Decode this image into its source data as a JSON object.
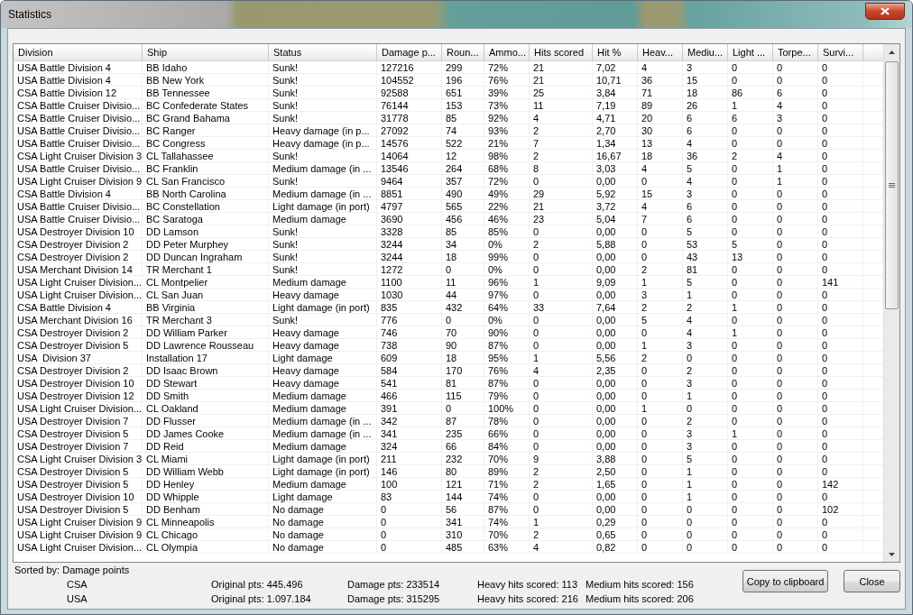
{
  "window": {
    "title": "Statistics"
  },
  "table": {
    "columns": [
      "Division",
      "Ship",
      "Status",
      "Damage p...",
      "Roun...",
      "Ammo...",
      "Hits scored",
      "Hit %",
      "Heav...",
      "Mediu...",
      "Light ...",
      "Torpe...",
      "Survi..."
    ],
    "rows": [
      [
        "USA Battle Division 4",
        "BB Idaho",
        "Sunk!",
        "127216",
        "299",
        "72%",
        "21",
        "7,02",
        "4",
        "3",
        "0",
        "0",
        "0"
      ],
      [
        "USA Battle Division 4",
        "BB New York",
        "Sunk!",
        "104552",
        "196",
        "76%",
        "21",
        "10,71",
        "36",
        "15",
        "0",
        "0",
        "0"
      ],
      [
        "CSA Battle Division 12",
        "BB Tennessee",
        "Sunk!",
        "92588",
        "651",
        "39%",
        "25",
        "3,84",
        "71",
        "18",
        "86",
        "6",
        "0"
      ],
      [
        "CSA Battle Cruiser Divisio...",
        "BC Confederate States",
        "Sunk!",
        "76144",
        "153",
        "73%",
        "11",
        "7,19",
        "89",
        "26",
        "1",
        "4",
        "0"
      ],
      [
        "CSA Battle Cruiser Divisio...",
        "BC Grand Bahama",
        "Sunk!",
        "31778",
        "85",
        "92%",
        "4",
        "4,71",
        "20",
        "6",
        "6",
        "3",
        "0"
      ],
      [
        "USA Battle Cruiser Divisio...",
        "BC Ranger",
        "Heavy damage (in p...",
        "27092",
        "74",
        "93%",
        "2",
        "2,70",
        "30",
        "6",
        "0",
        "0",
        "0"
      ],
      [
        "USA Battle Cruiser Divisio...",
        "BC Congress",
        "Heavy damage (in p...",
        "14576",
        "522",
        "21%",
        "7",
        "1,34",
        "13",
        "4",
        "0",
        "0",
        "0"
      ],
      [
        "CSA Light Cruiser Division 3",
        "CL Tallahassee",
        "Sunk!",
        "14064",
        "12",
        "98%",
        "2",
        "16,67",
        "18",
        "36",
        "2",
        "4",
        "0"
      ],
      [
        "USA Battle Cruiser Divisio...",
        "BC Franklin",
        "Medium damage (in ...",
        "13546",
        "264",
        "68%",
        "8",
        "3,03",
        "4",
        "5",
        "0",
        "1",
        "0"
      ],
      [
        "USA Light Cruiser Division 9",
        "CL San Francisco",
        "Sunk!",
        "9464",
        "357",
        "72%",
        "0",
        "0,00",
        "0",
        "4",
        "0",
        "1",
        "0"
      ],
      [
        "CSA Battle Division 4",
        "BB North Carolina",
        "Medium damage (in ...",
        "8851",
        "490",
        "49%",
        "29",
        "5,92",
        "15",
        "3",
        "0",
        "0",
        "0"
      ],
      [
        "USA Battle Cruiser Divisio...",
        "BC Constellation",
        "Light damage (in port)",
        "4797",
        "565",
        "22%",
        "21",
        "3,72",
        "4",
        "6",
        "0",
        "0",
        "0"
      ],
      [
        "USA Battle Cruiser Divisio...",
        "BC Saratoga",
        "Medium damage",
        "3690",
        "456",
        "46%",
        "23",
        "5,04",
        "7",
        "6",
        "0",
        "0",
        "0"
      ],
      [
        "USA Destroyer Division 10",
        "DD Lamson",
        "Sunk!",
        "3328",
        "85",
        "85%",
        "0",
        "0,00",
        "0",
        "5",
        "0",
        "0",
        "0"
      ],
      [
        "CSA Destroyer Division 2",
        "DD Peter Murphey",
        "Sunk!",
        "3244",
        "34",
        "0%",
        "2",
        "5,88",
        "0",
        "53",
        "5",
        "0",
        "0"
      ],
      [
        "CSA Destroyer Division 2",
        "DD Duncan Ingraham",
        "Sunk!",
        "3244",
        "18",
        "99%",
        "0",
        "0,00",
        "0",
        "43",
        "13",
        "0",
        "0"
      ],
      [
        "USA Merchant Division 14",
        "TR Merchant 1",
        "Sunk!",
        "1272",
        "0",
        "0%",
        "0",
        "0,00",
        "2",
        "81",
        "0",
        "0",
        "0"
      ],
      [
        "USA Light Cruiser Division...",
        "CL Montpelier",
        "Medium damage",
        "1100",
        "11",
        "96%",
        "1",
        "9,09",
        "1",
        "5",
        "0",
        "0",
        "141"
      ],
      [
        "USA Light Cruiser Division...",
        "CL San Juan",
        "Heavy damage",
        "1030",
        "44",
        "97%",
        "0",
        "0,00",
        "3",
        "1",
        "0",
        "0",
        "0"
      ],
      [
        "CSA Battle Division 4",
        "BB Virginia",
        "Light damage (in port)",
        "835",
        "432",
        "64%",
        "33",
        "7,64",
        "2",
        "2",
        "1",
        "0",
        "0"
      ],
      [
        "USA Merchant Division 16",
        "TR Merchant 3",
        "Sunk!",
        "776",
        "0",
        "0%",
        "0",
        "0,00",
        "5",
        "4",
        "0",
        "0",
        "0"
      ],
      [
        "CSA Destroyer Division 2",
        "DD William Parker",
        "Heavy damage",
        "746",
        "70",
        "90%",
        "0",
        "0,00",
        "0",
        "4",
        "1",
        "0",
        "0"
      ],
      [
        "CSA Destroyer Division 5",
        "DD Lawrence Rousseau",
        "Heavy damage",
        "738",
        "90",
        "87%",
        "0",
        "0,00",
        "1",
        "3",
        "0",
        "0",
        "0"
      ],
      [
        "USA  Division 37",
        "Installation 17",
        "Light damage",
        "609",
        "18",
        "95%",
        "1",
        "5,56",
        "2",
        "0",
        "0",
        "0",
        "0"
      ],
      [
        "CSA Destroyer Division 2",
        "DD Isaac Brown",
        "Heavy damage",
        "584",
        "170",
        "76%",
        "4",
        "2,35",
        "0",
        "2",
        "0",
        "0",
        "0"
      ],
      [
        "USA Destroyer Division 10",
        "DD Stewart",
        "Heavy damage",
        "541",
        "81",
        "87%",
        "0",
        "0,00",
        "0",
        "3",
        "0",
        "0",
        "0"
      ],
      [
        "USA Destroyer Division 12",
        "DD Smith",
        "Medium damage",
        "466",
        "115",
        "79%",
        "0",
        "0,00",
        "0",
        "1",
        "0",
        "0",
        "0"
      ],
      [
        "USA Light Cruiser Division...",
        "CL Oakland",
        "Medium damage",
        "391",
        "0",
        "100%",
        "0",
        "0,00",
        "1",
        "0",
        "0",
        "0",
        "0"
      ],
      [
        "USA Destroyer Division 7",
        "DD Flusser",
        "Medium damage (in ...",
        "342",
        "87",
        "78%",
        "0",
        "0,00",
        "0",
        "2",
        "0",
        "0",
        "0"
      ],
      [
        "CSA Destroyer Division 5",
        "DD James Cooke",
        "Medium damage (in ...",
        "341",
        "235",
        "66%",
        "0",
        "0,00",
        "0",
        "3",
        "1",
        "0",
        "0"
      ],
      [
        "USA Destroyer Division 7",
        "DD Reid",
        "Medium damage",
        "324",
        "66",
        "84%",
        "0",
        "0,00",
        "0",
        "3",
        "0",
        "0",
        "0"
      ],
      [
        "CSA Light Cruiser Division 3",
        "CL Miami",
        "Light damage (in port)",
        "211",
        "232",
        "70%",
        "9",
        "3,88",
        "0",
        "5",
        "0",
        "0",
        "0"
      ],
      [
        "CSA Destroyer Division 5",
        "DD William Webb",
        "Light damage (in port)",
        "146",
        "80",
        "89%",
        "2",
        "2,50",
        "0",
        "1",
        "0",
        "0",
        "0"
      ],
      [
        "USA Destroyer Division 5",
        "DD Henley",
        "Medium damage",
        "100",
        "121",
        "71%",
        "2",
        "1,65",
        "0",
        "1",
        "0",
        "0",
        "142"
      ],
      [
        "USA Destroyer Division 10",
        "DD Whipple",
        "Light damage",
        "83",
        "144",
        "74%",
        "0",
        "0,00",
        "0",
        "1",
        "0",
        "0",
        "0"
      ],
      [
        "USA Destroyer Division 5",
        "DD Benham",
        "No damage",
        "0",
        "56",
        "87%",
        "0",
        "0,00",
        "0",
        "0",
        "0",
        "0",
        "102"
      ],
      [
        "USA Light Cruiser Division 9",
        "CL Minneapolis",
        "No damage",
        "0",
        "341",
        "74%",
        "1",
        "0,29",
        "0",
        "0",
        "0",
        "0",
        "0"
      ],
      [
        "USA Light Cruiser Division 9",
        "CL Chicago",
        "No damage",
        "0",
        "310",
        "70%",
        "2",
        "0,65",
        "0",
        "0",
        "0",
        "0",
        "0"
      ],
      [
        "USA Light Cruiser Division...",
        "CL Olympia",
        "No damage",
        "0",
        "485",
        "63%",
        "4",
        "0,82",
        "0",
        "0",
        "0",
        "0",
        "0"
      ]
    ]
  },
  "sorted_by": "Sorted by: Damage points",
  "summary": [
    {
      "side": "CSA",
      "original": "Original pts: 445.496",
      "damage": "Damage pts: 233514",
      "heavy": "Heavy hits scored: 113",
      "medium": "Medium hits scored: 156"
    },
    {
      "side": "USA",
      "original": "Original pts: 1.097.184",
      "damage": "Damage pts: 315295",
      "heavy": "Heavy hits scored: 216",
      "medium": "Medium hits scored: 206"
    }
  ],
  "buttons": [
    "Copy to clipboard",
    "Close"
  ]
}
